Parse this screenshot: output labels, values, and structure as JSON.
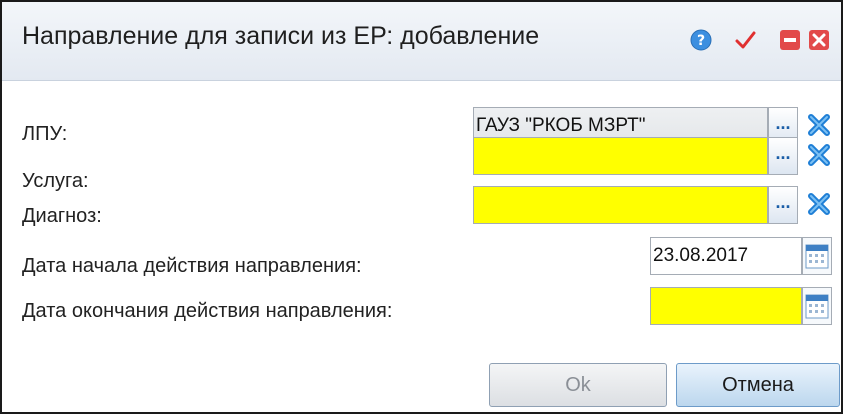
{
  "window": {
    "title": "Направление для записи из ЕР: добавление"
  },
  "titlebar_icons": [
    "help-icon",
    "check-icon",
    "minimize-icon",
    "close-icon"
  ],
  "fields": {
    "lpu": {
      "label": "ЛПУ:",
      "value": "ГАУЗ \"РКОБ МЗРТ\""
    },
    "service": {
      "label": "Услуга:",
      "value": ""
    },
    "diagnosis": {
      "label": "Диагноз:",
      "value": ""
    },
    "start_date": {
      "label": "Дата начала действия направления:",
      "value": "23.08.2017"
    },
    "end_date": {
      "label": "Дата окончания действия направления:",
      "value": ""
    }
  },
  "lookup_button_label": "...",
  "buttons": {
    "ok": "Ok",
    "cancel": "Отмена"
  },
  "colors": {
    "required": "#ffff00",
    "accent": "#1b5ea7"
  }
}
